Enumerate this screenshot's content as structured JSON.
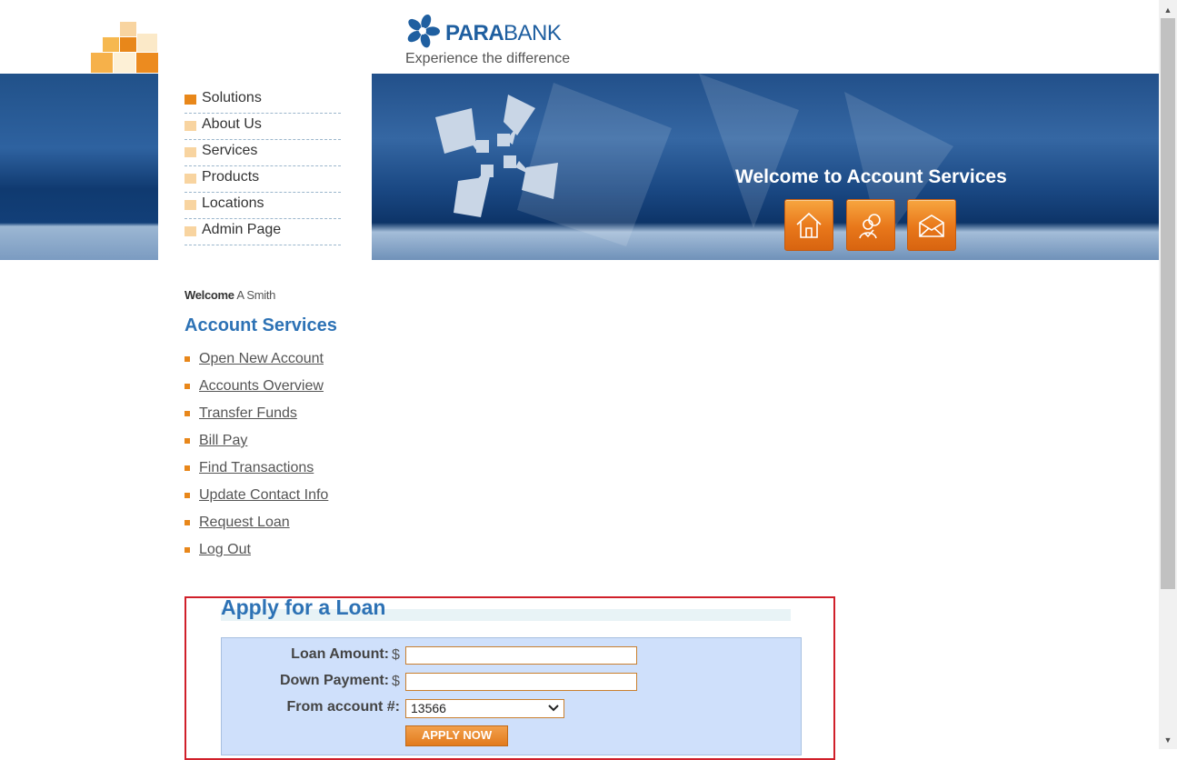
{
  "header": {
    "brand_part1": "PARA",
    "brand_part2": "BANK",
    "slogan": "Experience the difference",
    "brand_color": "#1f5fa0",
    "accent_color": "#e8871a"
  },
  "top_nav": {
    "items": [
      {
        "label": "Solutions",
        "active": true
      },
      {
        "label": "About Us"
      },
      {
        "label": "Services"
      },
      {
        "label": "Products"
      },
      {
        "label": "Locations"
      },
      {
        "label": "Admin Page"
      }
    ]
  },
  "banner": {
    "title": "Welcome to Account Services",
    "buttons": [
      "home-icon",
      "contact-icon",
      "email-icon"
    ]
  },
  "sidebar": {
    "welcome_label": "Welcome",
    "user_name": "A Smith",
    "title": "Account Services",
    "links": [
      "Open New Account",
      "Accounts Overview",
      "Transfer Funds",
      "Bill Pay",
      "Find Transactions",
      "Update Contact Info",
      "Request Loan",
      "Log Out"
    ]
  },
  "loan_form": {
    "title": "Apply for a Loan",
    "loan_amount_label": "Loan Amount:",
    "down_payment_label": "Down Payment:",
    "from_account_label": "From account #:",
    "currency_symbol": "$",
    "loan_amount_value": "",
    "down_payment_value": "",
    "from_account_value": "13566",
    "submit_label": "APPLY NOW"
  },
  "scrollbar": {
    "up_arrow": "▲",
    "down_arrow": "▼"
  }
}
